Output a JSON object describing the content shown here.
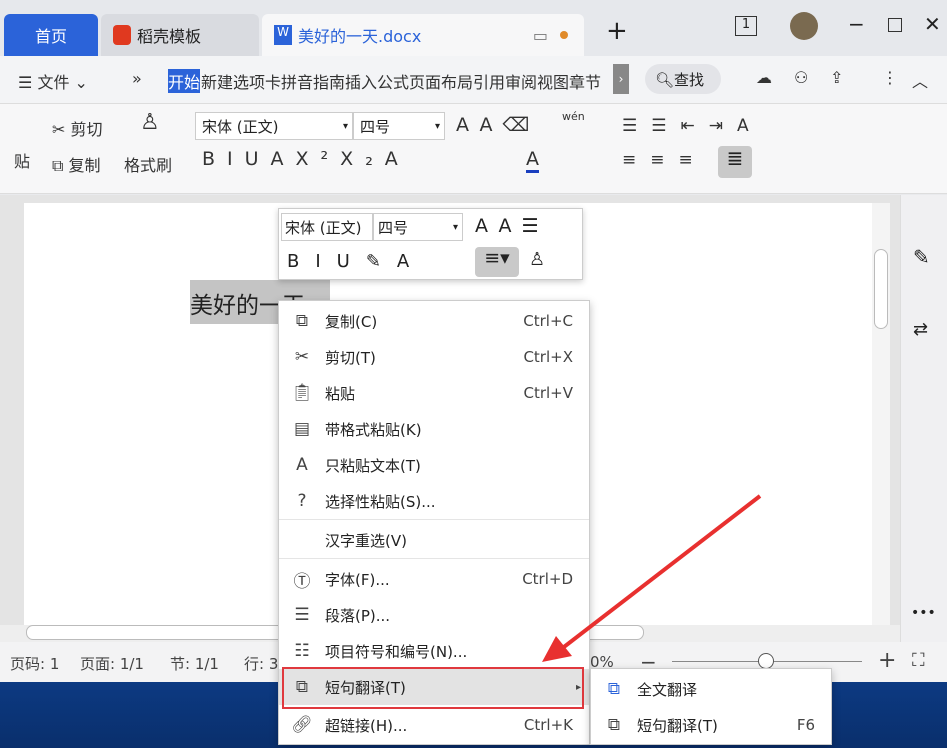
{
  "tabs": [
    {
      "label": "首页"
    },
    {
      "label": "稻壳模板"
    },
    {
      "label": "美好的一天.docx"
    }
  ],
  "window": {
    "page_count_icon": "1"
  },
  "menubar": {
    "file": "文件",
    "items": "新建选项卡拼音指南插入公式页面布局引用审阅视图章节",
    "active": "开始",
    "search": "查找"
  },
  "toolbar": {
    "cut": "剪切",
    "copy": "复制",
    "format_painter": "格式刷",
    "paste_partial": "贴",
    "font": "宋体 (正文)",
    "size": "四号",
    "pinyin": "wén"
  },
  "document": {
    "text": "美好的一天"
  },
  "mini_toolbar": {
    "font": "宋体 (正文)",
    "size": "四号"
  },
  "context_menu": {
    "items": [
      {
        "label": "复制(C)",
        "shortcut": "Ctrl+C",
        "icon": "copy-icon"
      },
      {
        "label": "剪切(T)",
        "shortcut": "Ctrl+X",
        "icon": "scissors-icon"
      },
      {
        "label": "粘贴",
        "shortcut": "Ctrl+V",
        "icon": "paste-icon"
      },
      {
        "label": "带格式粘贴(K)",
        "shortcut": "",
        "icon": "paste-format-icon"
      },
      {
        "label": "只粘贴文本(T)",
        "shortcut": "",
        "icon": "paste-text-icon"
      },
      {
        "label": "选择性粘贴(S)...",
        "shortcut": "",
        "icon": "paste-special-icon"
      },
      {
        "label": "汉字重选(V)",
        "shortcut": "",
        "icon": ""
      },
      {
        "label": "字体(F)...",
        "shortcut": "Ctrl+D",
        "icon": "font-icon"
      },
      {
        "label": "段落(P)...",
        "shortcut": "",
        "icon": "paragraph-icon"
      },
      {
        "label": "项目符号和编号(N)...",
        "shortcut": "",
        "icon": "bullets-icon"
      },
      {
        "label": "短句翻译(T)",
        "shortcut": "",
        "icon": "translate-icon"
      },
      {
        "label": "超链接(H)...",
        "shortcut": "Ctrl+K",
        "icon": "link-icon"
      }
    ]
  },
  "submenu": {
    "items": [
      {
        "label": "全文翻译",
        "shortcut": ""
      },
      {
        "label": "短句翻译(T)",
        "shortcut": "F6"
      }
    ]
  },
  "status": {
    "page_no": "页码: 1",
    "pages": "页面: 1/1",
    "section": "节: 1/1",
    "line": "行: 3",
    "zoom": "0%"
  },
  "colors": {
    "accent": "#2b63d9",
    "highlight_box": "#e0393e",
    "arrow": "#e8302f"
  }
}
